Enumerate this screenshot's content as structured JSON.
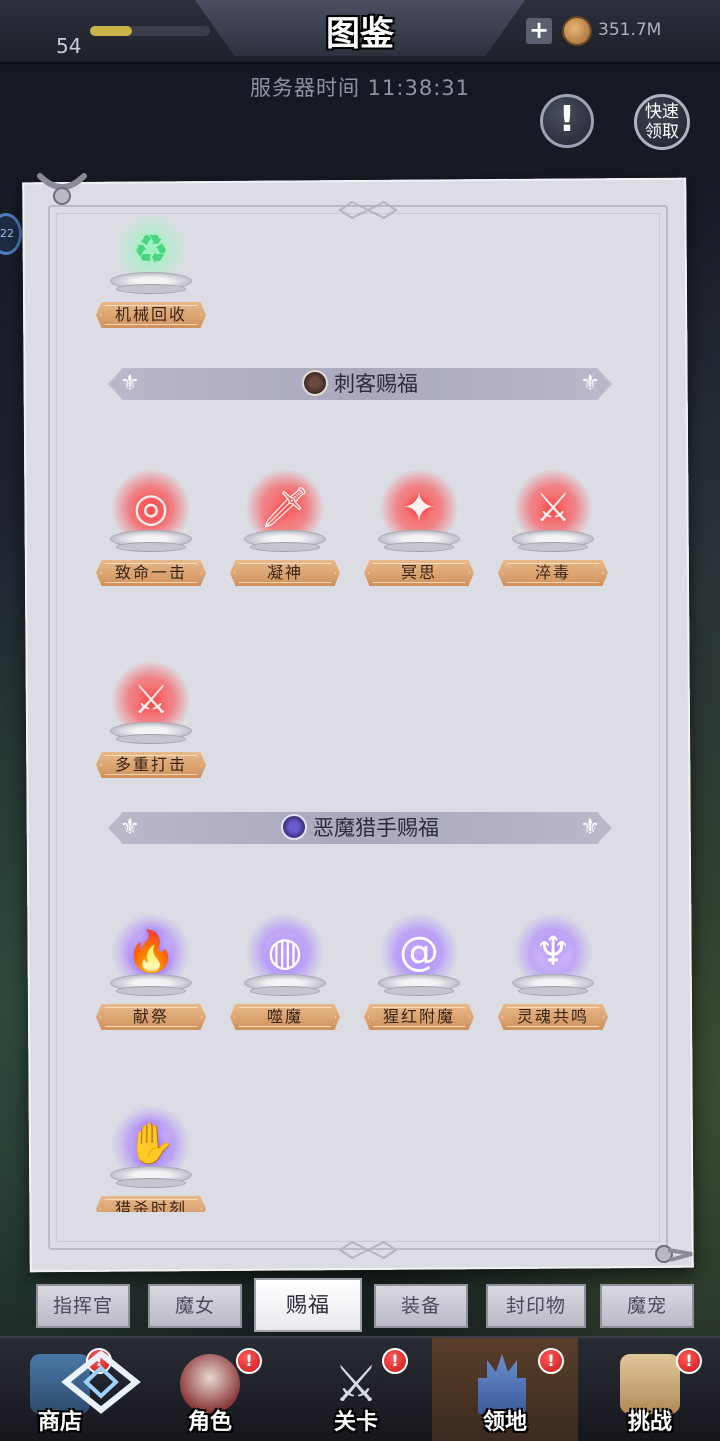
{
  "header": {
    "title": "图鉴",
    "level": "54",
    "xp_fraction": 0.35,
    "currency_amount": "351.7M",
    "server_time_label": "服务器时间 11:38:31"
  },
  "buttons": {
    "notice_symbol": "!",
    "quick_claim": "快速领取"
  },
  "side_bubble_text": "22",
  "sections": {
    "top_item": {
      "label": "机械回收",
      "icon": "recycle-icon"
    },
    "assassin": {
      "title": "刺客赐福",
      "items": [
        {
          "label": "致命一击",
          "icon": "target-icon"
        },
        {
          "label": "凝神",
          "icon": "kunai-icon"
        },
        {
          "label": "冥思",
          "icon": "shuriken-icon"
        },
        {
          "label": "淬毒",
          "icon": "poison-dagger-icon"
        },
        {
          "label": "多重打击",
          "icon": "multi-sword-icon"
        }
      ]
    },
    "demon_hunter": {
      "title": "恶魔猎手赐福",
      "items": [
        {
          "label": "献祭",
          "icon": "flame-icon"
        },
        {
          "label": "噬魔",
          "icon": "orb-slash-icon"
        },
        {
          "label": "猩红附魔",
          "icon": "vortex-icon"
        },
        {
          "label": "灵魂共鸣",
          "icon": "spirit-tower-icon"
        },
        {
          "label": "猎杀时刻",
          "icon": "hand-glow-icon"
        }
      ]
    }
  },
  "category_tabs": [
    "指挥官",
    "魔女",
    "赐福",
    "装备",
    "封印物",
    "魔宠"
  ],
  "active_tab": "赐福",
  "bottom_nav": [
    {
      "label": "商店",
      "badge": "!"
    },
    {
      "label": "角色",
      "badge": "!"
    },
    {
      "label": "关卡",
      "badge": "!"
    },
    {
      "label": "领地",
      "badge": "!"
    },
    {
      "label": "挑战",
      "badge": "!"
    }
  ],
  "colors": {
    "assassin_glow": "#ff3b3b",
    "hunter_glow": "#9b6cff",
    "label_plate": "#d9a06d",
    "paper": "#dcdde4"
  }
}
